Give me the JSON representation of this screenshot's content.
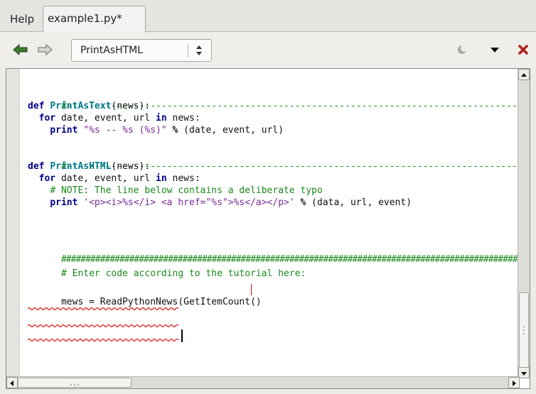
{
  "tabs": {
    "help": "Help",
    "file": "example1.py*"
  },
  "toolbar": {
    "back_icon": "back-arrow-icon",
    "forward_icon": "forward-arrow-icon",
    "function_combo_value": "PrintAsHTML",
    "right_icons": [
      "moon-icon",
      "dropdown-arrow-icon",
      "close-x-icon"
    ]
  },
  "code": {
    "line1_dashes": "#-----------------------------------------------------------------------------------",
    "line2_def": "def",
    "line2_name": "PrintAsText",
    "line2_rest": "(news):",
    "line3_for": "for",
    "line3_mid": " date, event, url ",
    "line3_in": "in",
    "line3_end": " news:",
    "line4_print": "print",
    "line4_str": "\"%s -- %s (%s)\"",
    "line4_pct": "%",
    "line4_end": " (date, event, url)",
    "line5_dashes": "#-----------------------------------------------------------------------------------",
    "line6_def": "def",
    "line6_name": "PrintAsHTML",
    "line6_rest": "(news):",
    "line7_for": "for",
    "line7_mid": " date, event, url ",
    "line7_in": "in",
    "line7_end": " news:",
    "line8_comment": "# NOTE: The line below contains a deliberate typo",
    "line9_print": "print",
    "line9_str": "'<p><i>%s</i> <a href=\"%s\">%s</a></p>'",
    "line9_pct": "%",
    "line9_end": " (data, url, event)",
    "line10_hashes": "##################################################################################################",
    "line11_comment": "# Enter code according to the tutorial here:",
    "line12_code": "mews = ReadPythonNews(GetItemCount()"
  },
  "colors": {
    "keyword": "#00008b",
    "function": "#007a8a",
    "string": "#7a2a9a",
    "comment": "#1a8a1a",
    "error_squiggle": "#e01010"
  }
}
